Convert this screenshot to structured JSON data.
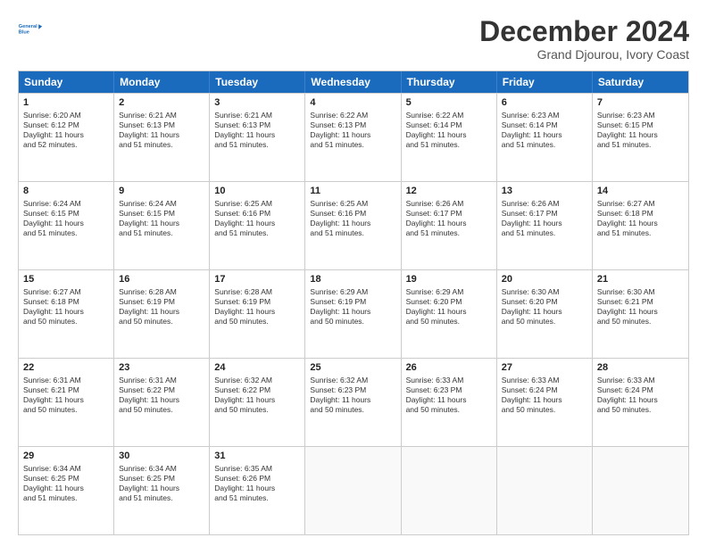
{
  "logo": {
    "line1": "General",
    "line2": "Blue"
  },
  "title": "December 2024",
  "subtitle": "Grand Djourou, Ivory Coast",
  "days": [
    "Sunday",
    "Monday",
    "Tuesday",
    "Wednesday",
    "Thursday",
    "Friday",
    "Saturday"
  ],
  "rows": [
    [
      {
        "num": "1",
        "lines": [
          "Sunrise: 6:20 AM",
          "Sunset: 6:12 PM",
          "Daylight: 11 hours",
          "and 52 minutes."
        ]
      },
      {
        "num": "2",
        "lines": [
          "Sunrise: 6:21 AM",
          "Sunset: 6:13 PM",
          "Daylight: 11 hours",
          "and 51 minutes."
        ]
      },
      {
        "num": "3",
        "lines": [
          "Sunrise: 6:21 AM",
          "Sunset: 6:13 PM",
          "Daylight: 11 hours",
          "and 51 minutes."
        ]
      },
      {
        "num": "4",
        "lines": [
          "Sunrise: 6:22 AM",
          "Sunset: 6:13 PM",
          "Daylight: 11 hours",
          "and 51 minutes."
        ]
      },
      {
        "num": "5",
        "lines": [
          "Sunrise: 6:22 AM",
          "Sunset: 6:14 PM",
          "Daylight: 11 hours",
          "and 51 minutes."
        ]
      },
      {
        "num": "6",
        "lines": [
          "Sunrise: 6:23 AM",
          "Sunset: 6:14 PM",
          "Daylight: 11 hours",
          "and 51 minutes."
        ]
      },
      {
        "num": "7",
        "lines": [
          "Sunrise: 6:23 AM",
          "Sunset: 6:15 PM",
          "Daylight: 11 hours",
          "and 51 minutes."
        ]
      }
    ],
    [
      {
        "num": "8",
        "lines": [
          "Sunrise: 6:24 AM",
          "Sunset: 6:15 PM",
          "Daylight: 11 hours",
          "and 51 minutes."
        ]
      },
      {
        "num": "9",
        "lines": [
          "Sunrise: 6:24 AM",
          "Sunset: 6:15 PM",
          "Daylight: 11 hours",
          "and 51 minutes."
        ]
      },
      {
        "num": "10",
        "lines": [
          "Sunrise: 6:25 AM",
          "Sunset: 6:16 PM",
          "Daylight: 11 hours",
          "and 51 minutes."
        ]
      },
      {
        "num": "11",
        "lines": [
          "Sunrise: 6:25 AM",
          "Sunset: 6:16 PM",
          "Daylight: 11 hours",
          "and 51 minutes."
        ]
      },
      {
        "num": "12",
        "lines": [
          "Sunrise: 6:26 AM",
          "Sunset: 6:17 PM",
          "Daylight: 11 hours",
          "and 51 minutes."
        ]
      },
      {
        "num": "13",
        "lines": [
          "Sunrise: 6:26 AM",
          "Sunset: 6:17 PM",
          "Daylight: 11 hours",
          "and 51 minutes."
        ]
      },
      {
        "num": "14",
        "lines": [
          "Sunrise: 6:27 AM",
          "Sunset: 6:18 PM",
          "Daylight: 11 hours",
          "and 51 minutes."
        ]
      }
    ],
    [
      {
        "num": "15",
        "lines": [
          "Sunrise: 6:27 AM",
          "Sunset: 6:18 PM",
          "Daylight: 11 hours",
          "and 50 minutes."
        ]
      },
      {
        "num": "16",
        "lines": [
          "Sunrise: 6:28 AM",
          "Sunset: 6:19 PM",
          "Daylight: 11 hours",
          "and 50 minutes."
        ]
      },
      {
        "num": "17",
        "lines": [
          "Sunrise: 6:28 AM",
          "Sunset: 6:19 PM",
          "Daylight: 11 hours",
          "and 50 minutes."
        ]
      },
      {
        "num": "18",
        "lines": [
          "Sunrise: 6:29 AM",
          "Sunset: 6:19 PM",
          "Daylight: 11 hours",
          "and 50 minutes."
        ]
      },
      {
        "num": "19",
        "lines": [
          "Sunrise: 6:29 AM",
          "Sunset: 6:20 PM",
          "Daylight: 11 hours",
          "and 50 minutes."
        ]
      },
      {
        "num": "20",
        "lines": [
          "Sunrise: 6:30 AM",
          "Sunset: 6:20 PM",
          "Daylight: 11 hours",
          "and 50 minutes."
        ]
      },
      {
        "num": "21",
        "lines": [
          "Sunrise: 6:30 AM",
          "Sunset: 6:21 PM",
          "Daylight: 11 hours",
          "and 50 minutes."
        ]
      }
    ],
    [
      {
        "num": "22",
        "lines": [
          "Sunrise: 6:31 AM",
          "Sunset: 6:21 PM",
          "Daylight: 11 hours",
          "and 50 minutes."
        ]
      },
      {
        "num": "23",
        "lines": [
          "Sunrise: 6:31 AM",
          "Sunset: 6:22 PM",
          "Daylight: 11 hours",
          "and 50 minutes."
        ]
      },
      {
        "num": "24",
        "lines": [
          "Sunrise: 6:32 AM",
          "Sunset: 6:22 PM",
          "Daylight: 11 hours",
          "and 50 minutes."
        ]
      },
      {
        "num": "25",
        "lines": [
          "Sunrise: 6:32 AM",
          "Sunset: 6:23 PM",
          "Daylight: 11 hours",
          "and 50 minutes."
        ]
      },
      {
        "num": "26",
        "lines": [
          "Sunrise: 6:33 AM",
          "Sunset: 6:23 PM",
          "Daylight: 11 hours",
          "and 50 minutes."
        ]
      },
      {
        "num": "27",
        "lines": [
          "Sunrise: 6:33 AM",
          "Sunset: 6:24 PM",
          "Daylight: 11 hours",
          "and 50 minutes."
        ]
      },
      {
        "num": "28",
        "lines": [
          "Sunrise: 6:33 AM",
          "Sunset: 6:24 PM",
          "Daylight: 11 hours",
          "and 50 minutes."
        ]
      }
    ],
    [
      {
        "num": "29",
        "lines": [
          "Sunrise: 6:34 AM",
          "Sunset: 6:25 PM",
          "Daylight: 11 hours",
          "and 51 minutes."
        ]
      },
      {
        "num": "30",
        "lines": [
          "Sunrise: 6:34 AM",
          "Sunset: 6:25 PM",
          "Daylight: 11 hours",
          "and 51 minutes."
        ]
      },
      {
        "num": "31",
        "lines": [
          "Sunrise: 6:35 AM",
          "Sunset: 6:26 PM",
          "Daylight: 11 hours",
          "and 51 minutes."
        ]
      },
      {
        "num": "",
        "lines": []
      },
      {
        "num": "",
        "lines": []
      },
      {
        "num": "",
        "lines": []
      },
      {
        "num": "",
        "lines": []
      }
    ]
  ]
}
